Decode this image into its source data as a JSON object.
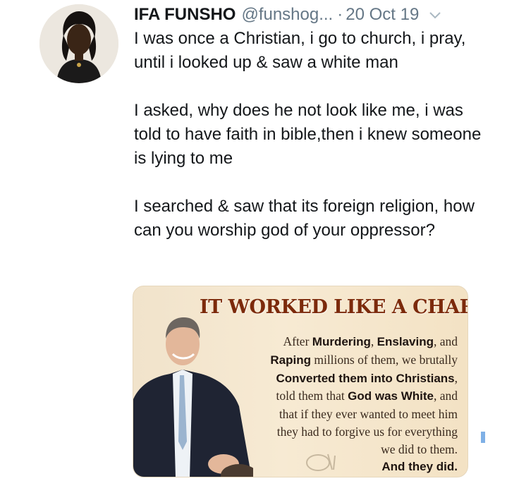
{
  "tweet": {
    "display_name": "IFA FUNSHO",
    "handle": "@funshog...",
    "separator": "·",
    "date": "20 Oct 19",
    "paragraphs": [
      "I was once a Christian, i go to church, i pray, until i looked up & saw a white man",
      "I asked, why does he not look like me, i was told to have faith in bible,then i knew someone is lying to me",
      "I searched & saw that its foreign religion, how can you worship god of your oppressor?"
    ],
    "media": {
      "headline": "IT WORKED LIKE A CHARM",
      "l1a": "After ",
      "l1b": "Murdering",
      "l1c": ", ",
      "l1d": "Enslaving",
      "l1e": ", and",
      "l2a": "Raping",
      "l2b": " millions of them, we brutally",
      "l3": "Converted them into Christians",
      "l3c": ",",
      "l4a": "told them that ",
      "l4b": "God was White",
      "l4c": ", and",
      "l5": "that if they ever wanted to meet him",
      "l6": "they had to forgive us for everything",
      "l7": "we did to them.",
      "l8": "And they did."
    }
  },
  "icons": {
    "caret": "chevron-down-icon",
    "avatar": "avatar"
  },
  "colors": {
    "text": "#14171a",
    "secondary": "#657786",
    "headline": "#7c2a0b"
  }
}
